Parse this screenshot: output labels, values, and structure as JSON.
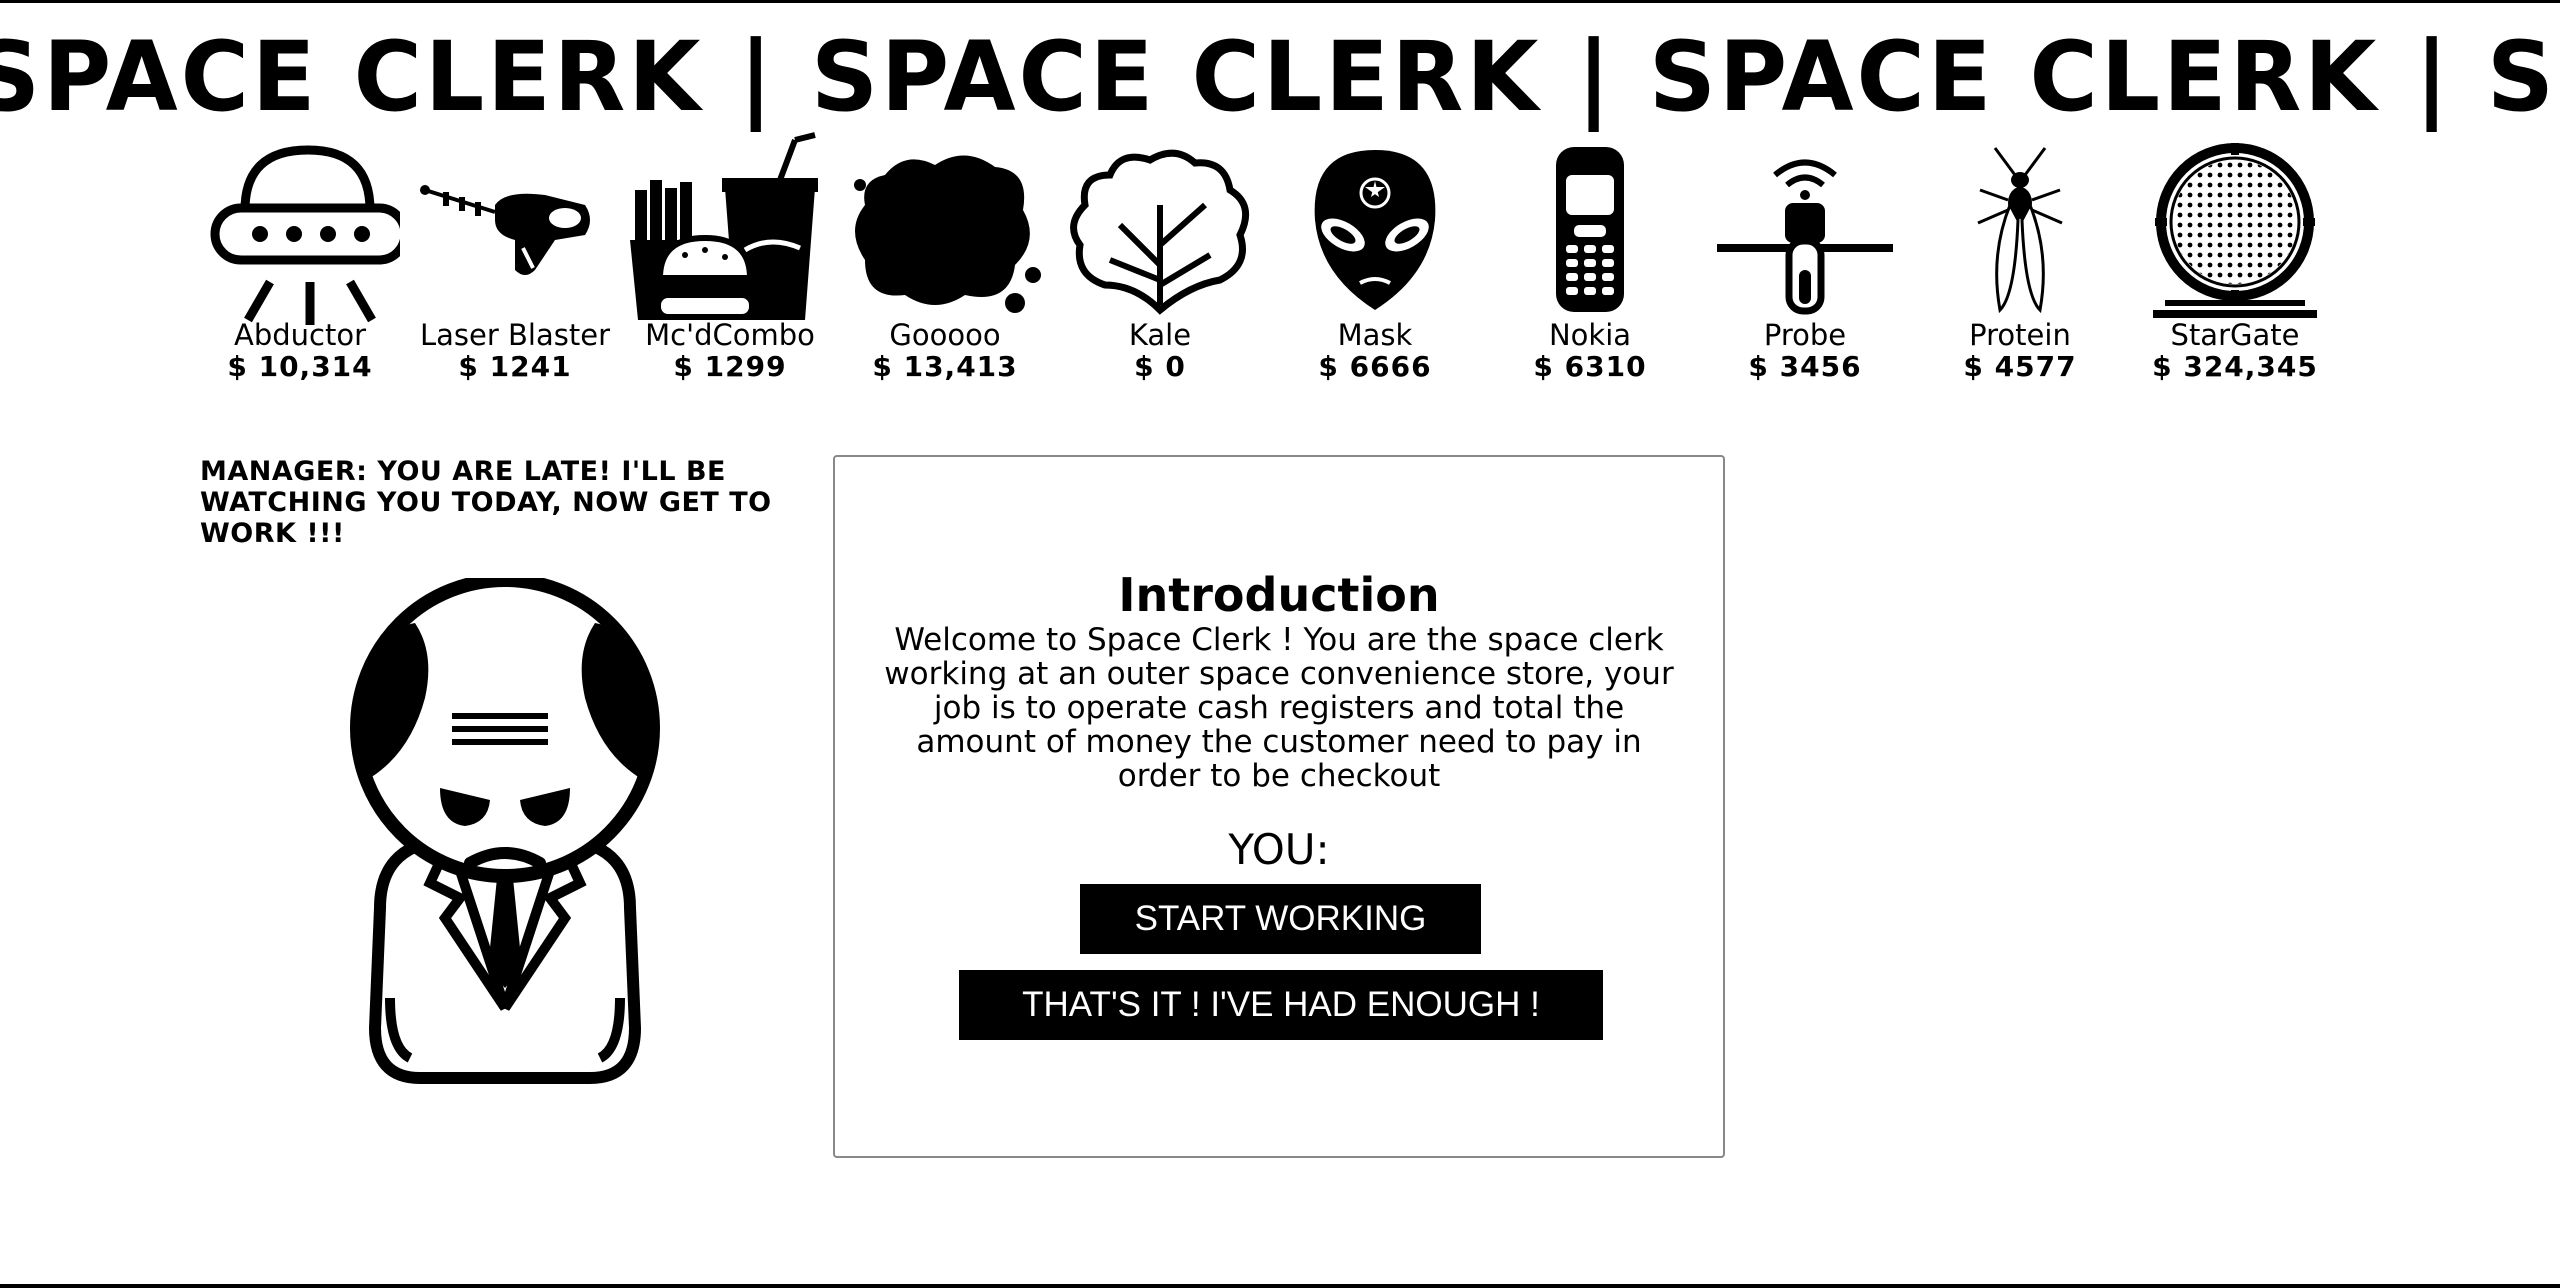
{
  "title": {
    "marquee_text": "SPACE CLERK | SPACE CLERK | SPACE CLERK | SPACE CLERK"
  },
  "products": [
    {
      "name": "Abductor",
      "price": "$ 10,314",
      "icon": "ufo-icon"
    },
    {
      "name": "Laser Blaster",
      "price": "$ 1241",
      "icon": "ray-gun-icon"
    },
    {
      "name": "Mc'dCombo",
      "price": "$ 1299",
      "icon": "burger-combo-icon"
    },
    {
      "name": "Gooooo",
      "price": "$ 13,413",
      "icon": "goo-splat-icon"
    },
    {
      "name": "Kale",
      "price": "$ 0",
      "icon": "kale-icon"
    },
    {
      "name": "Mask",
      "price": "$ 6666",
      "icon": "alien-mask-icon"
    },
    {
      "name": "Nokia",
      "price": "$ 6310",
      "icon": "nokia-phone-icon"
    },
    {
      "name": "Probe",
      "price": "$ 3456",
      "icon": "probe-icon"
    },
    {
      "name": "Protein",
      "price": "$ 4577",
      "icon": "insect-icon"
    },
    {
      "name": "StarGate",
      "price": "$ 324,345",
      "icon": "stargate-icon"
    }
  ],
  "manager": {
    "message": "MANAGER: YOU ARE LATE! I'LL BE WATCHING YOU TODAY, NOW GET TO WORK !!!",
    "figure_icon": "angry-manager-icon"
  },
  "intro": {
    "title": "Introduction",
    "body": "Welcome to Space Clerk ! You are the space clerk working at an outer space convenience store, your job is to operate cash registers and total the amount of money the customer need to pay in order to be checkout",
    "you_label": "YOU:",
    "start_button": "START WORKING",
    "quit_button": "THAT'S IT ! I'VE HAD ENOUGH !"
  }
}
